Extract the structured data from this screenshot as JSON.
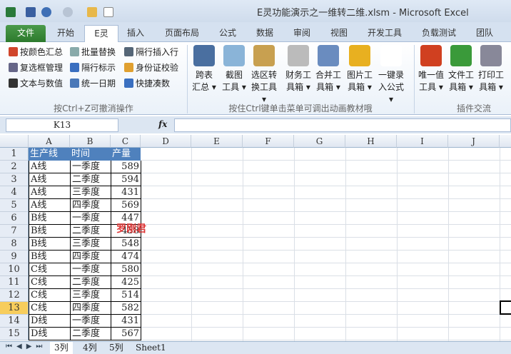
{
  "window": {
    "title": "E灵功能演示之一维转二维.xlsm - Microsoft Excel"
  },
  "tabs": [
    "文件",
    "开始",
    "E灵",
    "插入",
    "页面布局",
    "公式",
    "数据",
    "审阅",
    "视图",
    "开发工具",
    "负载测试",
    "团队"
  ],
  "ribbon": {
    "small_items": [
      "按颜色汇总",
      "批量替换",
      "隔行插入行",
      "复选框管理",
      "隔行标示",
      "身份证校验",
      "文本与数值",
      "统一日期",
      "快捷凑数"
    ],
    "group1_label": "按Ctrl+Z可撤消操作",
    "big_buttons": [
      [
        "跨表",
        "汇总 ▾"
      ],
      [
        "截图",
        "工具 ▾"
      ],
      [
        "选区转",
        "换工具 ▾"
      ],
      [
        "财务工",
        "具箱 ▾"
      ],
      [
        "合并工",
        "具箱 ▾"
      ],
      [
        "图片工",
        "具箱 ▾"
      ],
      [
        "一键录",
        "入公式 ▾"
      ],
      [
        "唯一值",
        "工具 ▾"
      ],
      [
        "文件工",
        "具箱 ▾"
      ],
      [
        "打印工",
        "具箱 ▾"
      ]
    ],
    "group2_label": "按住Ctrl键单击菜单可调出动画教材哦",
    "group3_label": "插件交流"
  },
  "formula_bar": {
    "name_box": "K13",
    "fx": "fx",
    "formula": ""
  },
  "columns": [
    "A",
    "B",
    "C",
    "D",
    "E",
    "F",
    "G",
    "H",
    "I",
    "J"
  ],
  "rows": [
    "1",
    "2",
    "3",
    "4",
    "5",
    "6",
    "7",
    "8",
    "9",
    "10",
    "11",
    "12",
    "13",
    "14",
    "15"
  ],
  "selected_row": "13",
  "table": {
    "headers": [
      "生产线",
      "时间",
      "产量"
    ],
    "data": [
      [
        "A线",
        "一季度",
        "589"
      ],
      [
        "A线",
        "二季度",
        "594"
      ],
      [
        "A线",
        "三季度",
        "431"
      ],
      [
        "A线",
        "四季度",
        "569"
      ],
      [
        "B线",
        "一季度",
        "447"
      ],
      [
        "B线",
        "二季度",
        "438"
      ],
      [
        "B线",
        "三季度",
        "548"
      ],
      [
        "B线",
        "四季度",
        "474"
      ],
      [
        "C线",
        "一季度",
        "580"
      ],
      [
        "C线",
        "二季度",
        "425"
      ],
      [
        "C线",
        "三季度",
        "514"
      ],
      [
        "C线",
        "四季度",
        "582"
      ],
      [
        "D线",
        "一季度",
        "431"
      ],
      [
        "D线",
        "二季度",
        "567"
      ]
    ]
  },
  "watermark": "罗刚君",
  "sheet_tabs": [
    "3列",
    "4列",
    "5列",
    "Sheet1"
  ],
  "active_sheet": "3列",
  "colors": {
    "header_fill": "#4f81bd",
    "selected_row": "#f7cd5c",
    "file_tab": "#2d7a2d"
  }
}
